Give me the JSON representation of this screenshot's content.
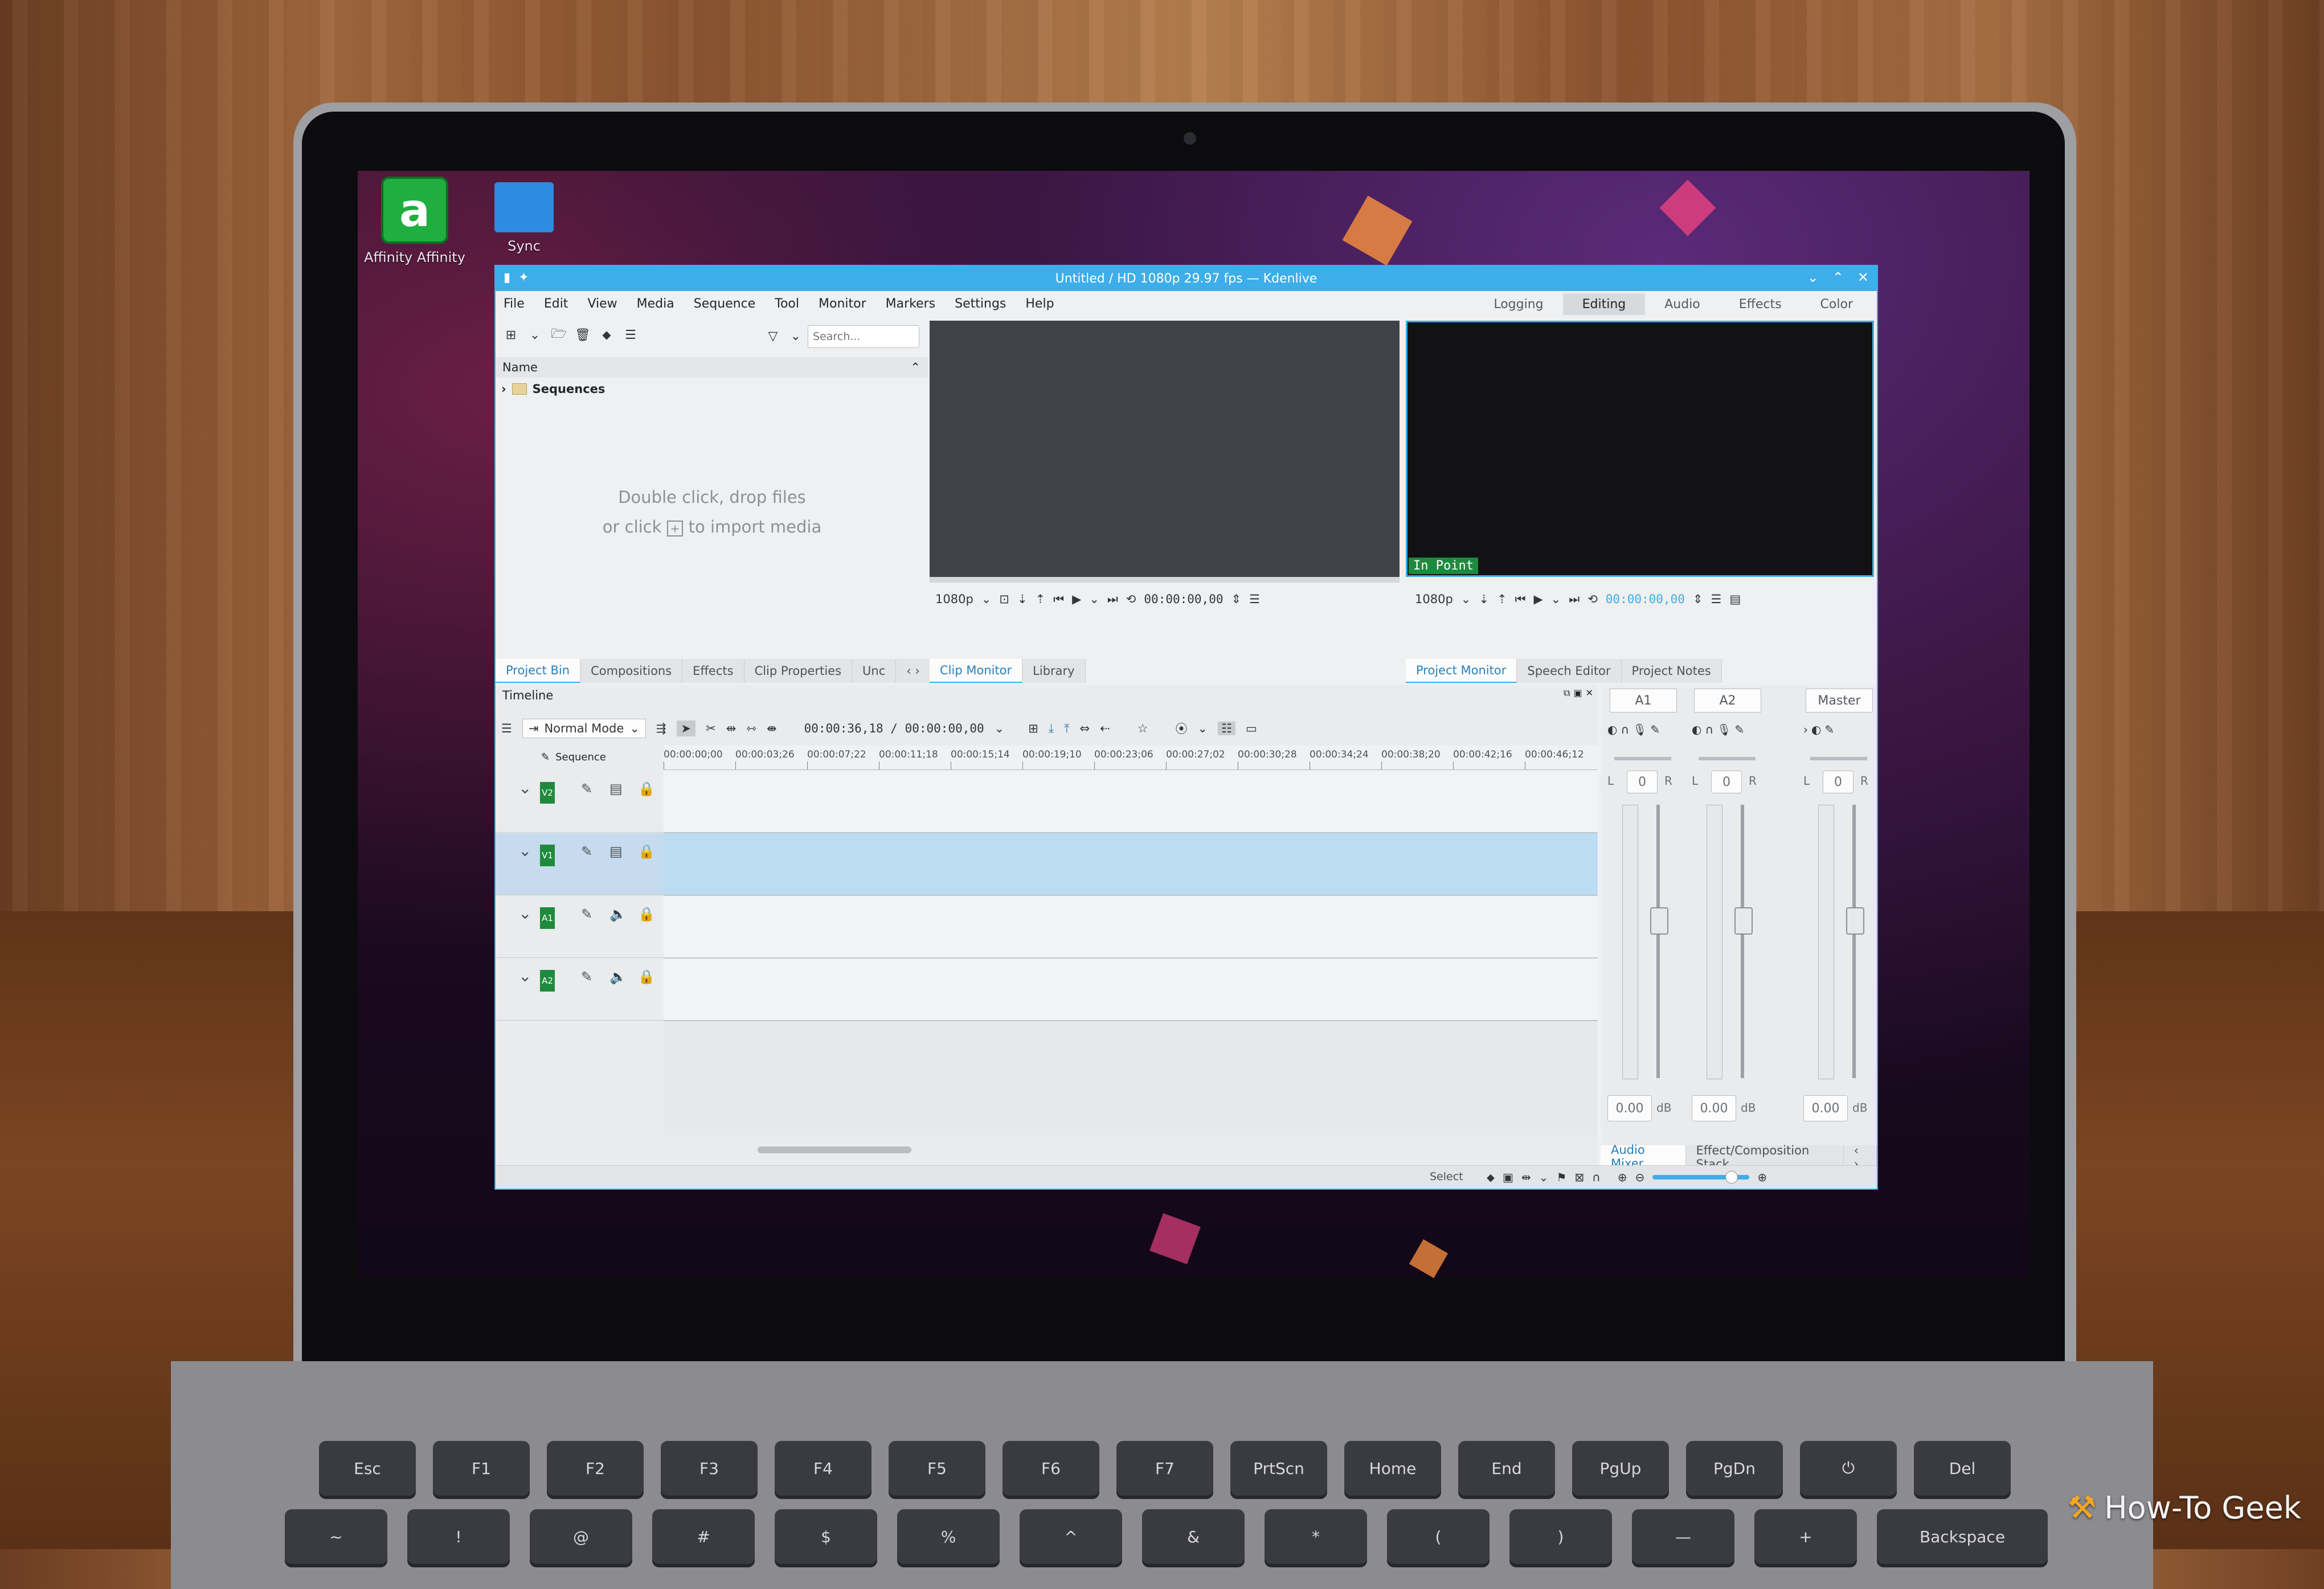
{
  "desktop": {
    "icons": [
      {
        "label": "Affinity Affinity",
        "icon": "affinity-app-icon",
        "color": "#1fae3f"
      },
      {
        "label": "Sync",
        "icon": "folder-icon",
        "color": "#2f8be0"
      }
    ]
  },
  "window": {
    "title": "Untitled / HD 1080p 29.97 fps — Kdenlive",
    "accent": "#3daee9",
    "menu": [
      "File",
      "Edit",
      "View",
      "Media",
      "Sequence",
      "Tool",
      "Monitor",
      "Markers",
      "Settings",
      "Help"
    ],
    "layouts": [
      {
        "label": "Logging",
        "active": false
      },
      {
        "label": "Editing",
        "active": true
      },
      {
        "label": "Audio",
        "active": false
      },
      {
        "label": "Effects",
        "active": false
      },
      {
        "label": "Color",
        "active": false
      }
    ]
  },
  "project_bin": {
    "search_placeholder": "Search...",
    "column_header": "Name",
    "folder": "Sequences",
    "empty_line1": "Double click, drop files",
    "empty_line2_a": "or click",
    "empty_line2_b": "to import media",
    "tabs": [
      {
        "label": "Project Bin",
        "selected": true
      },
      {
        "label": "Compositions",
        "selected": false
      },
      {
        "label": "Effects",
        "selected": false
      },
      {
        "label": "Clip Properties",
        "selected": false
      },
      {
        "label": "Unc",
        "selected": false
      }
    ]
  },
  "clip_monitor": {
    "resolution": "1080p",
    "timecode": "00:00:00,00",
    "tabs": [
      {
        "label": "Clip Monitor",
        "selected": true
      },
      {
        "label": "Library",
        "selected": false
      }
    ]
  },
  "project_monitor": {
    "resolution": "1080p",
    "timecode": "00:00:00,00",
    "overlay": "In Point",
    "overlay_color": "#1f8a3d",
    "tabs": [
      {
        "label": "Project Monitor",
        "selected": true
      },
      {
        "label": "Speech Editor",
        "selected": false
      },
      {
        "label": "Project Notes",
        "selected": false
      }
    ]
  },
  "timeline": {
    "title": "Timeline",
    "mode": "Normal Mode",
    "timecode": "00:00:36,18 / 00:00:00,00",
    "sequence_label": "Sequence",
    "ruler": [
      "00:00:00;00",
      "00:00:03;26",
      "00:00:07;22",
      "00:00:11;18",
      "00:00:15;14",
      "00:00:19;10",
      "00:00:23;06",
      "00:00:27;02",
      "00:00:30;28",
      "00:00:34;24",
      "00:00:38;20",
      "00:00:42;16",
      "00:00:46;12"
    ],
    "tracks": [
      {
        "id": "V2",
        "type": "video",
        "selected": false
      },
      {
        "id": "V1",
        "type": "video",
        "selected": true
      },
      {
        "id": "A1",
        "type": "audio",
        "selected": false
      },
      {
        "id": "A2",
        "type": "audio",
        "selected": false
      }
    ]
  },
  "audio_mixer": {
    "channels": [
      {
        "name": "A1",
        "L": "L",
        "pan": "0",
        "R": "R",
        "gain": "0.00",
        "unit": "dB"
      },
      {
        "name": "A2",
        "L": "L",
        "pan": "0",
        "R": "R",
        "gain": "0.00",
        "unit": "dB"
      },
      {
        "name": "Master",
        "L": "L",
        "pan": "0",
        "R": "R",
        "gain": "0.00",
        "unit": "dB"
      }
    ],
    "tabs": [
      {
        "label": "Audio Mixer",
        "selected": true
      },
      {
        "label": "Effect/Composition Stack",
        "selected": false
      }
    ]
  },
  "statusbar": {
    "tool": "Select"
  },
  "keyboard": {
    "row1": [
      "Esc",
      "F1",
      "F2",
      "F3",
      "F4",
      "F5",
      "F6",
      "F7",
      "PrtScn",
      "Home",
      "End",
      "PgUp",
      "PgDn",
      "⏻",
      "Del"
    ],
    "row2": [
      "~",
      "!",
      "@",
      "#",
      "$",
      "%",
      "^",
      "&",
      "*",
      "(",
      ")",
      "—",
      "+",
      "Backspace"
    ]
  },
  "watermark": "How-To Geek"
}
